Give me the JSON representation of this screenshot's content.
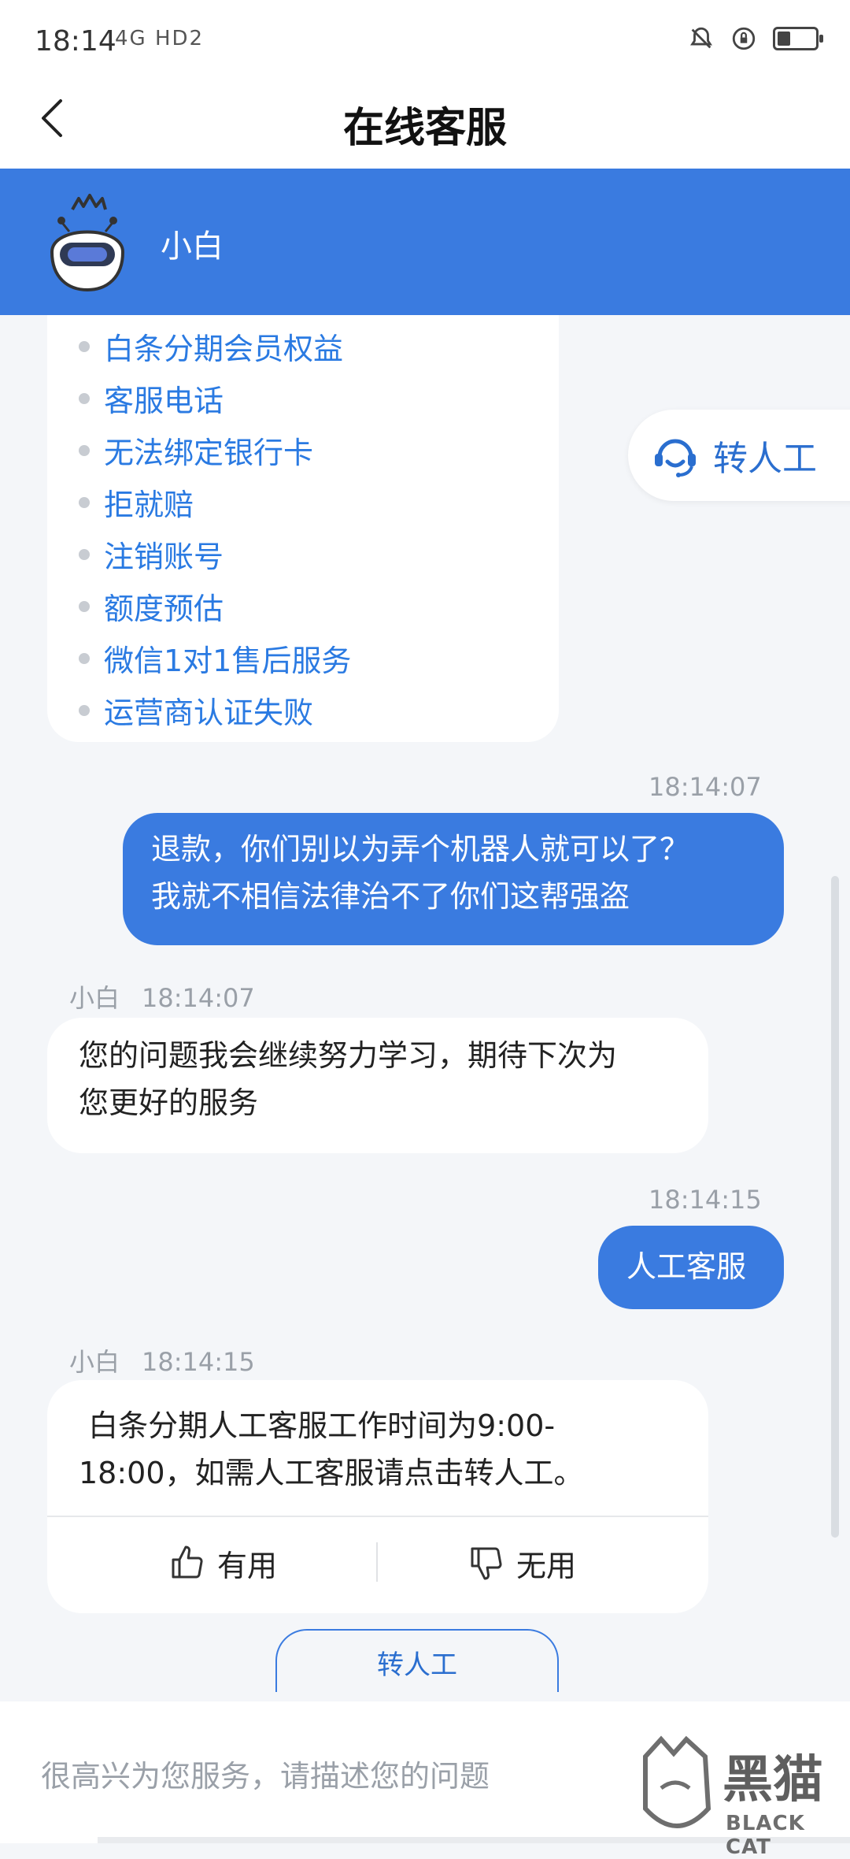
{
  "status_bar": {
    "time": "18:14",
    "signal": "4G HD2",
    "battery_level": 0.35
  },
  "header": {
    "title": "在线客服"
  },
  "bot": {
    "name": "小白"
  },
  "menu": {
    "items": [
      "白条分期会员权益",
      "客服电话",
      "无法绑定银行卡",
      "拒就赔",
      "注销账号",
      "额度预估",
      "微信1对1售后服务",
      "运营商认证失败"
    ]
  },
  "float_button": {
    "label": "转人工"
  },
  "messages": {
    "m1": {
      "time": "18:14:07",
      "line1": "退款，你们别以为弄个机器人就可以了？",
      "line2": "我就不相信法律治不了你们这帮强盗"
    },
    "m2": {
      "sender": "小白",
      "time": "18:14:07",
      "line1": "您的问题我会继续努力学习，期待下次为",
      "line2": "您更好的服务"
    },
    "m3": {
      "time": "18:14:15",
      "text": "人工客服"
    },
    "m4": {
      "sender": "小白",
      "time": "18:14:15",
      "line1": " 白条分期人工客服工作时间为9:00-",
      "line2": "18:00，如需人工客服请点击转人工。"
    }
  },
  "feedback": {
    "useful": "有用",
    "useless": "无用"
  },
  "transfer_button": {
    "label": "转人工"
  },
  "input": {
    "placeholder": "很高兴为您服务，请描述您的问题",
    "value": ""
  },
  "watermark": {
    "cn": "黑猫",
    "en": "BLACK CAT"
  },
  "colors": {
    "primary": "#3a7be0",
    "link": "#2a7ae2",
    "background": "#f4f6f9"
  }
}
